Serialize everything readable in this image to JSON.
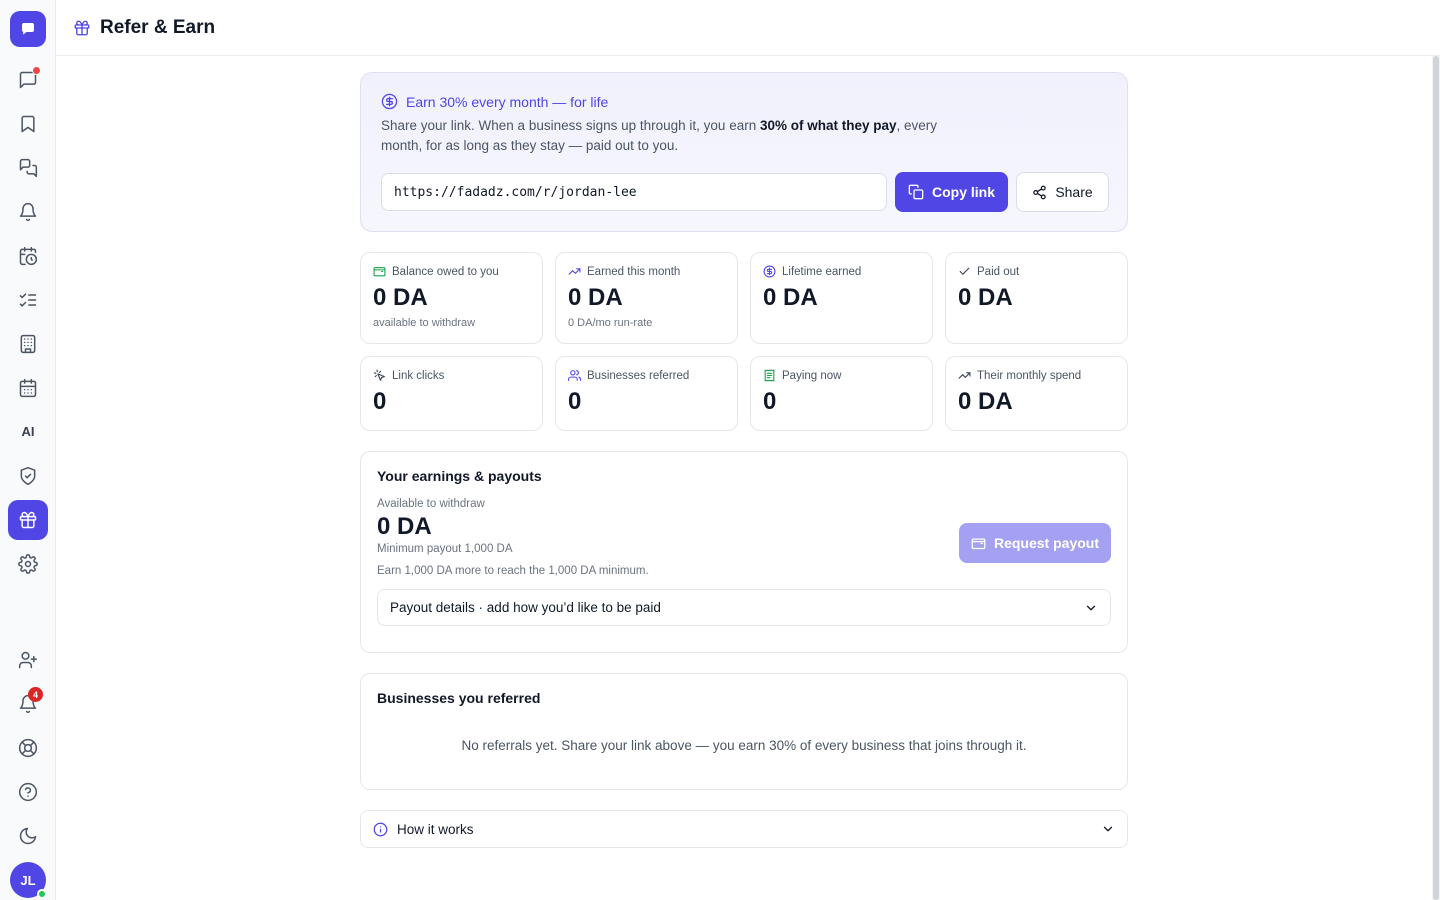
{
  "app": {
    "initials": "JL",
    "notification_count": "4"
  },
  "header": {
    "title": "Refer & Earn"
  },
  "hero": {
    "headline": "Earn 30% every month — for life",
    "desc_before": "Share your link. When a business signs up through it, you earn ",
    "desc_bold": "30% of what they pay",
    "desc_after": ", every month, for as long as they stay — paid out to you.",
    "link_value": "https://fadadz.com/r/jordan-lee",
    "copy_label": "Copy link",
    "share_label": "Share"
  },
  "stats": [
    {
      "label": "Balance owed to you",
      "value": "0 DA",
      "sub": "available to withdraw",
      "icon": "wallet-icon"
    },
    {
      "label": "Earned this month",
      "value": "0 DA",
      "sub": "0 DA/mo run-rate",
      "icon": "trending-up-icon"
    },
    {
      "label": "Lifetime earned",
      "value": "0 DA",
      "sub": "",
      "icon": "dollar-circle-icon"
    },
    {
      "label": "Paid out",
      "value": "0 DA",
      "sub": "",
      "icon": "check-icon"
    },
    {
      "label": "Link clicks",
      "value": "0",
      "icon": "pointer-click-icon"
    },
    {
      "label": "Businesses referred",
      "value": "0",
      "icon": "users-icon"
    },
    {
      "label": "Paying now",
      "value": "0",
      "icon": "receipt-icon"
    },
    {
      "label": "Their monthly spend",
      "value": "0 DA",
      "icon": "trending-up-icon"
    }
  ],
  "earnings": {
    "title": "Your earnings & payouts",
    "available_label": "Available to withdraw",
    "available_value": "0 DA",
    "minimum_text": "Minimum payout 1,000 DA",
    "more_text": "Earn 1,000 DA more to reach the 1,000 DA minimum.",
    "request_label": "Request payout",
    "payout_details_label": "Payout details · add how you’d like to be paid"
  },
  "referred": {
    "title": "Businesses you referred",
    "empty_text": "No referrals yet. Share your link above — you earn 30% of every business that joins through it."
  },
  "how": {
    "label": "How it works"
  },
  "colors": {
    "accent": "#4f46e5",
    "accent_disabled": "#a5a1f2",
    "hero_bg": "#f1f1fd",
    "badge_red": "#dc2626",
    "online_green": "#22c55e"
  }
}
